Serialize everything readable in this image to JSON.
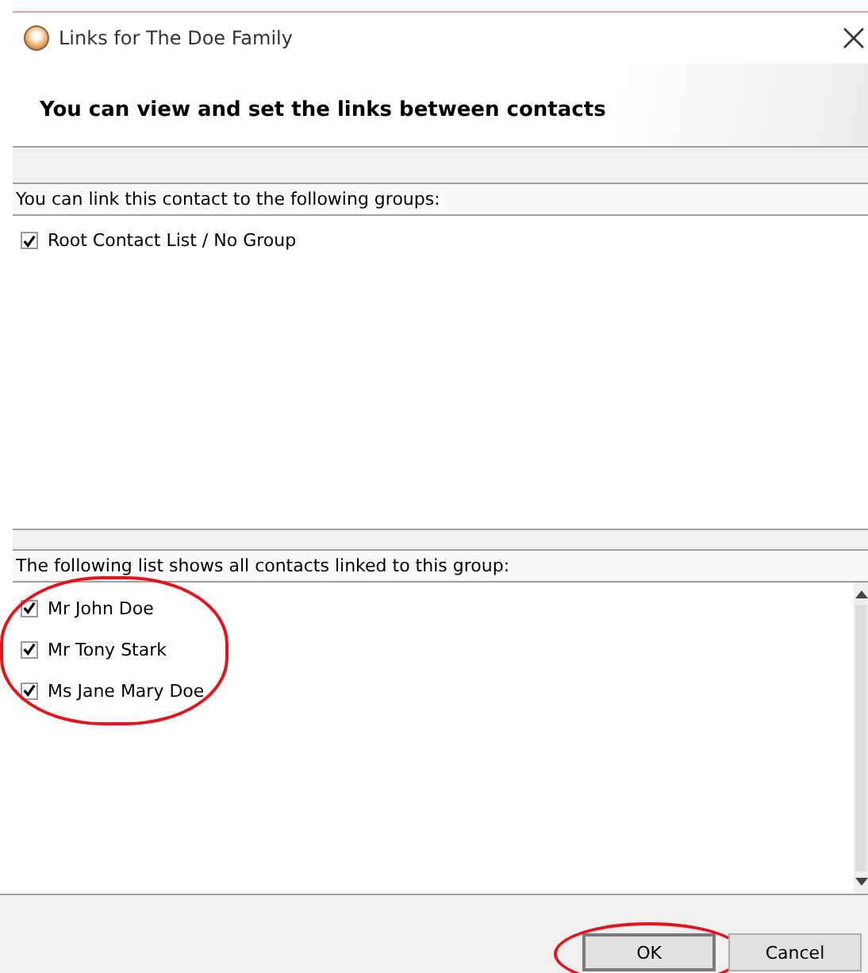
{
  "window": {
    "title": "Links for The Doe Family"
  },
  "header": {
    "title": "You can view and set the links between contacts"
  },
  "groups": {
    "label": "You can link this contact to the following groups:",
    "items": [
      {
        "name": "Root Contact List / No Group",
        "checked": true
      }
    ]
  },
  "contacts": {
    "label": "The following list shows all contacts linked to this group:",
    "items": [
      {
        "name": "Mr John Doe",
        "checked": true
      },
      {
        "name": "Mr Tony Stark",
        "checked": true
      },
      {
        "name": "Ms Jane Mary Doe",
        "checked": true
      }
    ]
  },
  "buttons": [
    {
      "label": "OK",
      "default": true
    },
    {
      "label": "Cancel",
      "default": false
    }
  ]
}
